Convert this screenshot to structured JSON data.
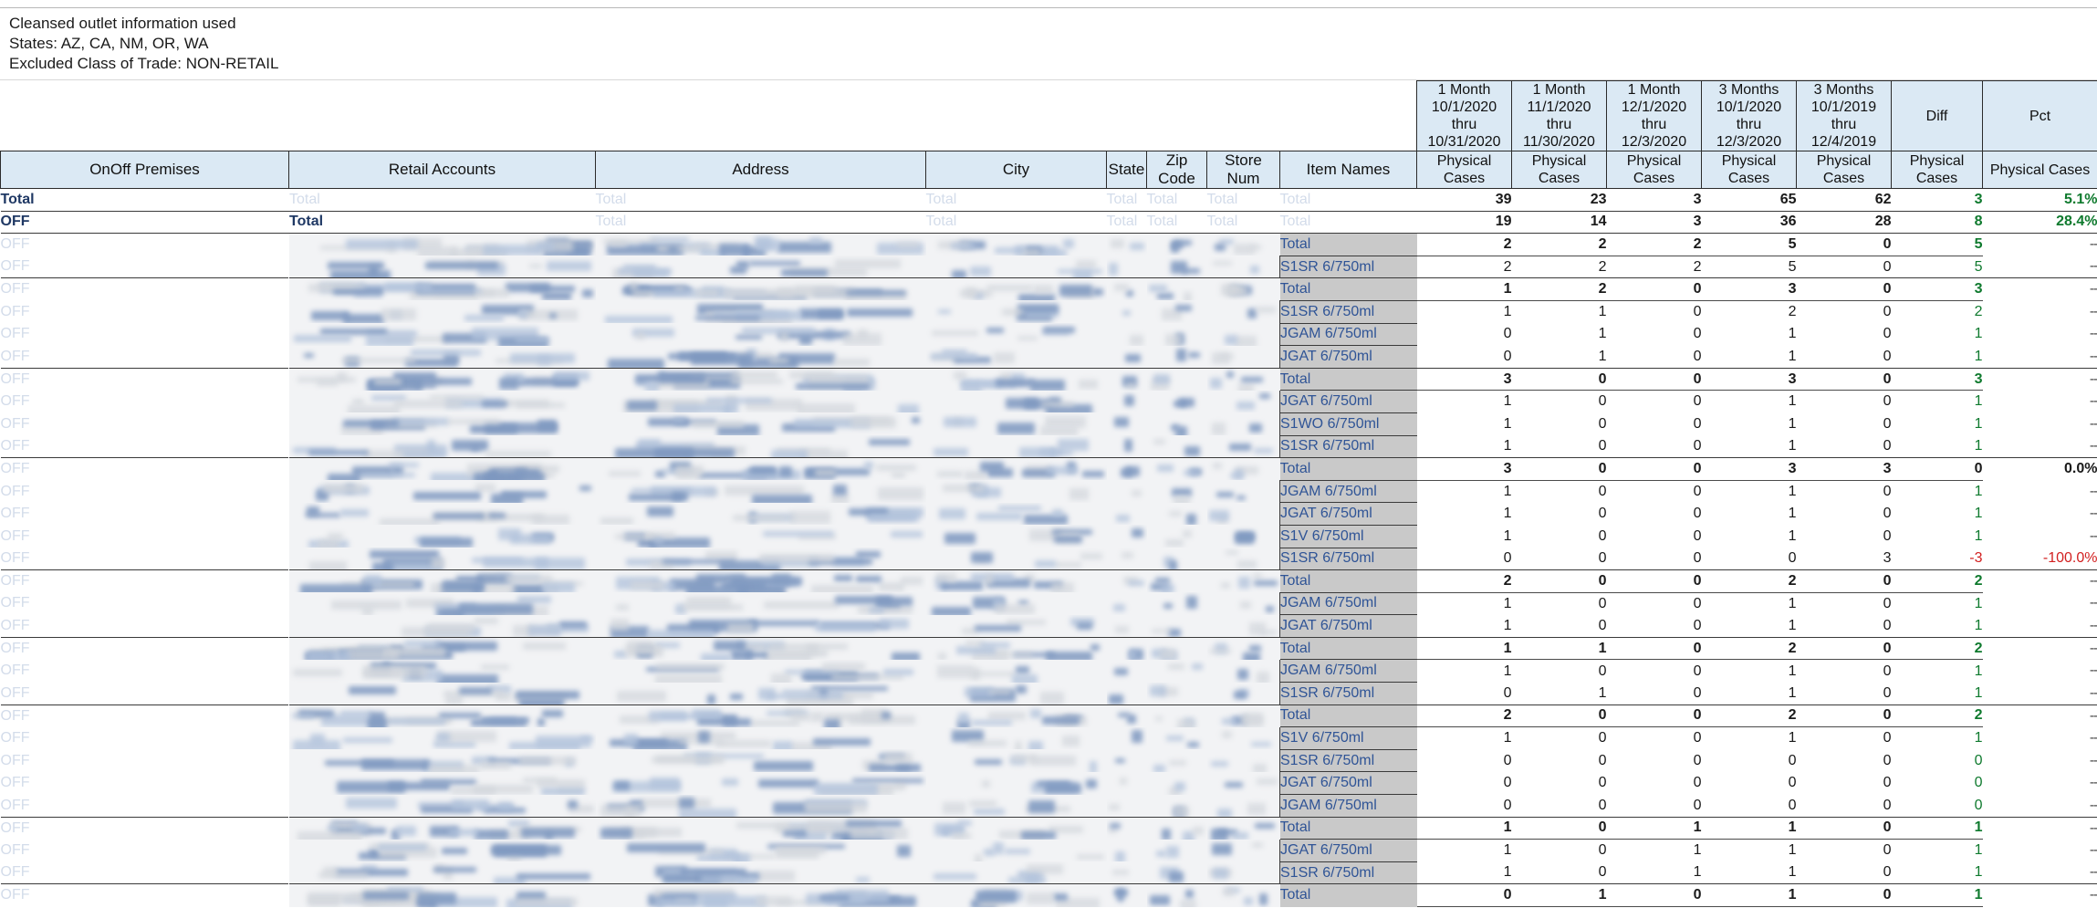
{
  "notes": {
    "lines": [
      "Cleansed outlet information used",
      "States: AZ, CA, NM, OR, WA",
      "Excluded Class of Trade: NON-RETAIL"
    ]
  },
  "colors": {
    "header_bg": "#dbe9f4",
    "item_col_bg": "#c9c9c9",
    "item_text": "#2f5496",
    "positive": "#0f7a2e",
    "negative": "#d22020",
    "dim_text": "#d3dcea"
  },
  "table": {
    "left_headers": [
      "OnOff Premises",
      "Retail Accounts",
      "Address",
      "City",
      "State",
      "Zip Code",
      "Store Num",
      "Item Names"
    ],
    "period_headers": [
      {
        "label": "1 Month",
        "start": "10/1/2020",
        "thru": "thru",
        "end": "10/31/2020",
        "measure": "Physical Cases"
      },
      {
        "label": "1 Month",
        "start": "11/1/2020",
        "thru": "thru",
        "end": "11/30/2020",
        "measure": "Physical Cases"
      },
      {
        "label": "1 Month",
        "start": "12/1/2020",
        "thru": "thru",
        "end": "12/3/2020",
        "measure": "Physical Cases"
      },
      {
        "label": "3 Months",
        "start": "10/1/2020",
        "thru": "thru",
        "end": "12/3/2020",
        "measure": "Physical Cases"
      },
      {
        "label": "3 Months",
        "start": "10/1/2019",
        "thru": "thru",
        "end": "12/4/2019",
        "measure": "Physical Cases"
      }
    ],
    "diff_header": {
      "label": "Diff",
      "measure": "Physical Cases"
    },
    "pct_header": {
      "label": "Pct",
      "measure": "Physical Cases"
    },
    "total_label": "Total",
    "off_label": "OFF",
    "dash": "--",
    "rows": [
      {
        "kind": "grand",
        "onoff": "Total",
        "account": "Total",
        "item": "Total",
        "v": [
          "39",
          "23",
          "3",
          "65",
          "62"
        ],
        "diff": "3",
        "pct": "5.1%",
        "diff_sign": "pos",
        "pct_sign": "pos"
      },
      {
        "kind": "subtotal",
        "onoff": "OFF",
        "account": "Total",
        "item": "Total",
        "v": [
          "19",
          "14",
          "3",
          "36",
          "28"
        ],
        "diff": "8",
        "pct": "28.4%",
        "diff_sign": "pos",
        "pct_sign": "pos"
      },
      {
        "kind": "group",
        "onoff": "OFF",
        "item": "Total",
        "v": [
          "2",
          "2",
          "2",
          "5",
          "0"
        ],
        "diff": "5",
        "pct": "--",
        "diff_sign": "pos",
        "pct_sign": "dash"
      },
      {
        "kind": "item",
        "onoff": "OFF",
        "item": "S1SR 6/750ml",
        "v": [
          "2",
          "2",
          "2",
          "5",
          "0"
        ],
        "diff": "5",
        "pct": "--",
        "diff_sign": "pos",
        "pct_sign": "dash"
      },
      {
        "kind": "group",
        "onoff": "OFF",
        "item": "Total",
        "v": [
          "1",
          "2",
          "0",
          "3",
          "0"
        ],
        "diff": "3",
        "pct": "--",
        "diff_sign": "pos",
        "pct_sign": "dash"
      },
      {
        "kind": "item",
        "onoff": "OFF",
        "item": "S1SR 6/750ml",
        "v": [
          "1",
          "1",
          "0",
          "2",
          "0"
        ],
        "diff": "2",
        "pct": "--",
        "diff_sign": "pos",
        "pct_sign": "dash"
      },
      {
        "kind": "item",
        "onoff": "OFF",
        "item": "JGAM 6/750ml",
        "v": [
          "0",
          "1",
          "0",
          "1",
          "0"
        ],
        "diff": "1",
        "pct": "--",
        "diff_sign": "pos",
        "pct_sign": "dash"
      },
      {
        "kind": "item",
        "onoff": "OFF",
        "item": "JGAT 6/750ml",
        "v": [
          "0",
          "1",
          "0",
          "1",
          "0"
        ],
        "diff": "1",
        "pct": "--",
        "diff_sign": "pos",
        "pct_sign": "dash"
      },
      {
        "kind": "group",
        "onoff": "OFF",
        "item": "Total",
        "v": [
          "3",
          "0",
          "0",
          "3",
          "0"
        ],
        "diff": "3",
        "pct": "--",
        "diff_sign": "pos",
        "pct_sign": "dash"
      },
      {
        "kind": "item",
        "onoff": "OFF",
        "item": "JGAT 6/750ml",
        "v": [
          "1",
          "0",
          "0",
          "1",
          "0"
        ],
        "diff": "1",
        "pct": "--",
        "diff_sign": "pos",
        "pct_sign": "dash"
      },
      {
        "kind": "item",
        "onoff": "OFF",
        "item": "S1WO 6/750ml",
        "v": [
          "1",
          "0",
          "0",
          "1",
          "0"
        ],
        "diff": "1",
        "pct": "--",
        "diff_sign": "pos",
        "pct_sign": "dash"
      },
      {
        "kind": "item",
        "onoff": "OFF",
        "item": "S1SR 6/750ml",
        "v": [
          "1",
          "0",
          "0",
          "1",
          "0"
        ],
        "diff": "1",
        "pct": "--",
        "diff_sign": "pos",
        "pct_sign": "dash"
      },
      {
        "kind": "group",
        "onoff": "OFF",
        "item": "Total",
        "v": [
          "3",
          "0",
          "0",
          "3",
          "3"
        ],
        "diff": "0",
        "pct": "0.0%",
        "diff_sign": "plain",
        "pct_sign": "plain"
      },
      {
        "kind": "item",
        "onoff": "OFF",
        "item": "JGAM 6/750ml",
        "v": [
          "1",
          "0",
          "0",
          "1",
          "0"
        ],
        "diff": "1",
        "pct": "--",
        "diff_sign": "pos",
        "pct_sign": "dash"
      },
      {
        "kind": "item",
        "onoff": "OFF",
        "item": "JGAT 6/750ml",
        "v": [
          "1",
          "0",
          "0",
          "1",
          "0"
        ],
        "diff": "1",
        "pct": "--",
        "diff_sign": "pos",
        "pct_sign": "dash"
      },
      {
        "kind": "item",
        "onoff": "OFF",
        "item": "S1V 6/750ml",
        "v": [
          "1",
          "0",
          "0",
          "1",
          "0"
        ],
        "diff": "1",
        "pct": "--",
        "diff_sign": "pos",
        "pct_sign": "dash"
      },
      {
        "kind": "item",
        "onoff": "OFF",
        "item": "S1SR 6/750ml",
        "v": [
          "0",
          "0",
          "0",
          "0",
          "3"
        ],
        "diff": "-3",
        "pct": "-100.0%",
        "diff_sign": "neg",
        "pct_sign": "neg"
      },
      {
        "kind": "group",
        "onoff": "OFF",
        "item": "Total",
        "v": [
          "2",
          "0",
          "0",
          "2",
          "0"
        ],
        "diff": "2",
        "pct": "--",
        "diff_sign": "pos",
        "pct_sign": "dash"
      },
      {
        "kind": "item",
        "onoff": "OFF",
        "item": "JGAM 6/750ml",
        "v": [
          "1",
          "0",
          "0",
          "1",
          "0"
        ],
        "diff": "1",
        "pct": "--",
        "diff_sign": "pos",
        "pct_sign": "dash"
      },
      {
        "kind": "item",
        "onoff": "OFF",
        "item": "JGAT 6/750ml",
        "v": [
          "1",
          "0",
          "0",
          "1",
          "0"
        ],
        "diff": "1",
        "pct": "--",
        "diff_sign": "pos",
        "pct_sign": "dash"
      },
      {
        "kind": "group",
        "onoff": "OFF",
        "item": "Total",
        "v": [
          "1",
          "1",
          "0",
          "2",
          "0"
        ],
        "diff": "2",
        "pct": "--",
        "diff_sign": "pos",
        "pct_sign": "dash"
      },
      {
        "kind": "item",
        "onoff": "OFF",
        "item": "JGAM 6/750ml",
        "v": [
          "1",
          "0",
          "0",
          "1",
          "0"
        ],
        "diff": "1",
        "pct": "--",
        "diff_sign": "pos",
        "pct_sign": "dash"
      },
      {
        "kind": "item",
        "onoff": "OFF",
        "item": "S1SR 6/750ml",
        "v": [
          "0",
          "1",
          "0",
          "1",
          "0"
        ],
        "diff": "1",
        "pct": "--",
        "diff_sign": "pos",
        "pct_sign": "dash"
      },
      {
        "kind": "group",
        "onoff": "OFF",
        "item": "Total",
        "v": [
          "2",
          "0",
          "0",
          "2",
          "0"
        ],
        "diff": "2",
        "pct": "--",
        "diff_sign": "pos",
        "pct_sign": "dash"
      },
      {
        "kind": "item",
        "onoff": "OFF",
        "item": "S1V 6/750ml",
        "v": [
          "1",
          "0",
          "0",
          "1",
          "0"
        ],
        "diff": "1",
        "pct": "--",
        "diff_sign": "pos",
        "pct_sign": "dash"
      },
      {
        "kind": "item",
        "onoff": "OFF",
        "item": "S1SR 6/750ml",
        "v": [
          "0",
          "0",
          "0",
          "0",
          "0"
        ],
        "diff": "0",
        "pct": "--",
        "diff_sign": "pos",
        "pct_sign": "dash"
      },
      {
        "kind": "item",
        "onoff": "OFF",
        "item": "JGAT 6/750ml",
        "v": [
          "0",
          "0",
          "0",
          "0",
          "0"
        ],
        "diff": "0",
        "pct": "--",
        "diff_sign": "pos",
        "pct_sign": "dash"
      },
      {
        "kind": "item",
        "onoff": "OFF",
        "item": "JGAM 6/750ml",
        "v": [
          "0",
          "0",
          "0",
          "0",
          "0"
        ],
        "diff": "0",
        "pct": "--",
        "diff_sign": "pos",
        "pct_sign": "dash"
      },
      {
        "kind": "group",
        "onoff": "OFF",
        "item": "Total",
        "v": [
          "1",
          "0",
          "1",
          "1",
          "0"
        ],
        "diff": "1",
        "pct": "--",
        "diff_sign": "pos",
        "pct_sign": "dash"
      },
      {
        "kind": "item",
        "onoff": "OFF",
        "item": "JGAT 6/750ml",
        "v": [
          "1",
          "0",
          "1",
          "1",
          "0"
        ],
        "diff": "1",
        "pct": "--",
        "diff_sign": "pos",
        "pct_sign": "dash"
      },
      {
        "kind": "item",
        "onoff": "OFF",
        "item": "S1SR 6/750ml",
        "v": [
          "1",
          "0",
          "1",
          "1",
          "0"
        ],
        "diff": "1",
        "pct": "--",
        "diff_sign": "pos",
        "pct_sign": "dash"
      },
      {
        "kind": "group",
        "onoff": "OFF",
        "item": "Total",
        "v": [
          "0",
          "1",
          "0",
          "1",
          "0"
        ],
        "diff": "1",
        "pct": "--",
        "diff_sign": "pos",
        "pct_sign": "dash"
      }
    ]
  }
}
